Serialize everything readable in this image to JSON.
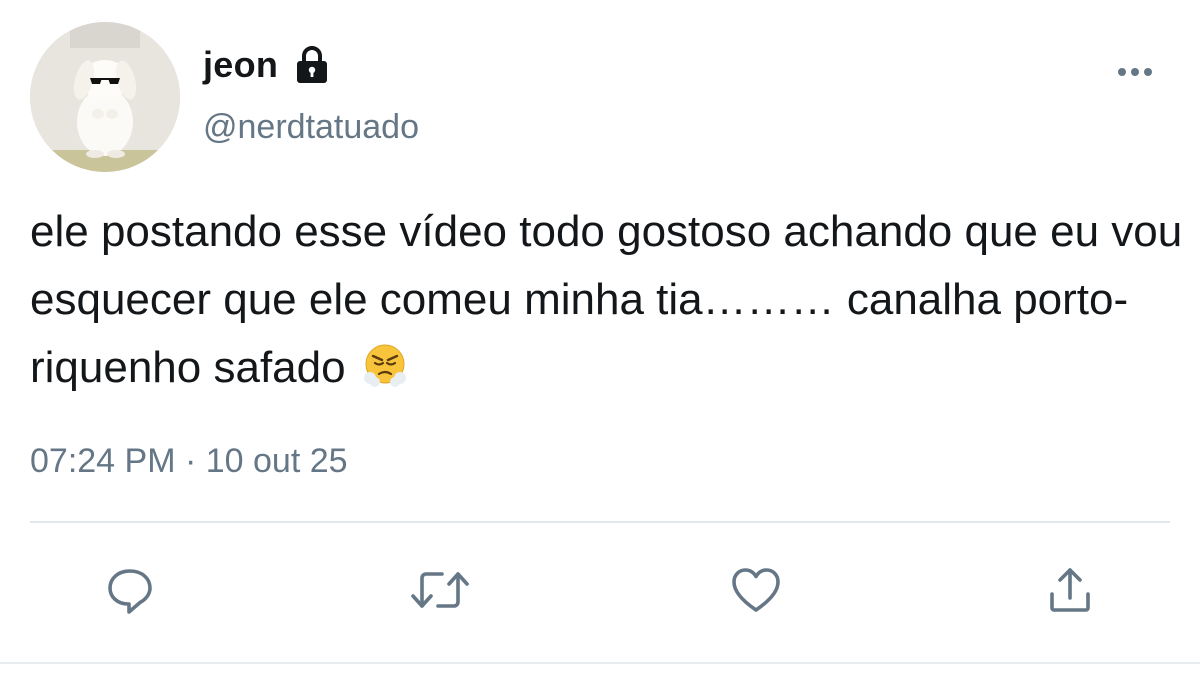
{
  "user": {
    "display_name": "jeon",
    "handle": "@nerdtatuado",
    "protected_icon": "lock-icon",
    "avatar_icon": "bunny-with-sunglasses-avatar"
  },
  "tweet": {
    "text": "ele postando esse vídeo todo gostoso achando que eu vou esquecer que ele comeu minha tia……… canalha porto-riquenho safado",
    "emoji": "face-with-steam-from-nose",
    "timestamp": "07:24 PM · 10 out 25"
  },
  "actions": [
    {
      "name": "reply",
      "icon": "reply-icon"
    },
    {
      "name": "retweet",
      "icon": "retweet-icon"
    },
    {
      "name": "like",
      "icon": "heart-icon"
    },
    {
      "name": "share",
      "icon": "share-icon"
    }
  ],
  "colors": {
    "text_primary": "#14171a",
    "text_secondary": "#657786",
    "icon": "#657786",
    "divider": "#e1e8ed"
  }
}
